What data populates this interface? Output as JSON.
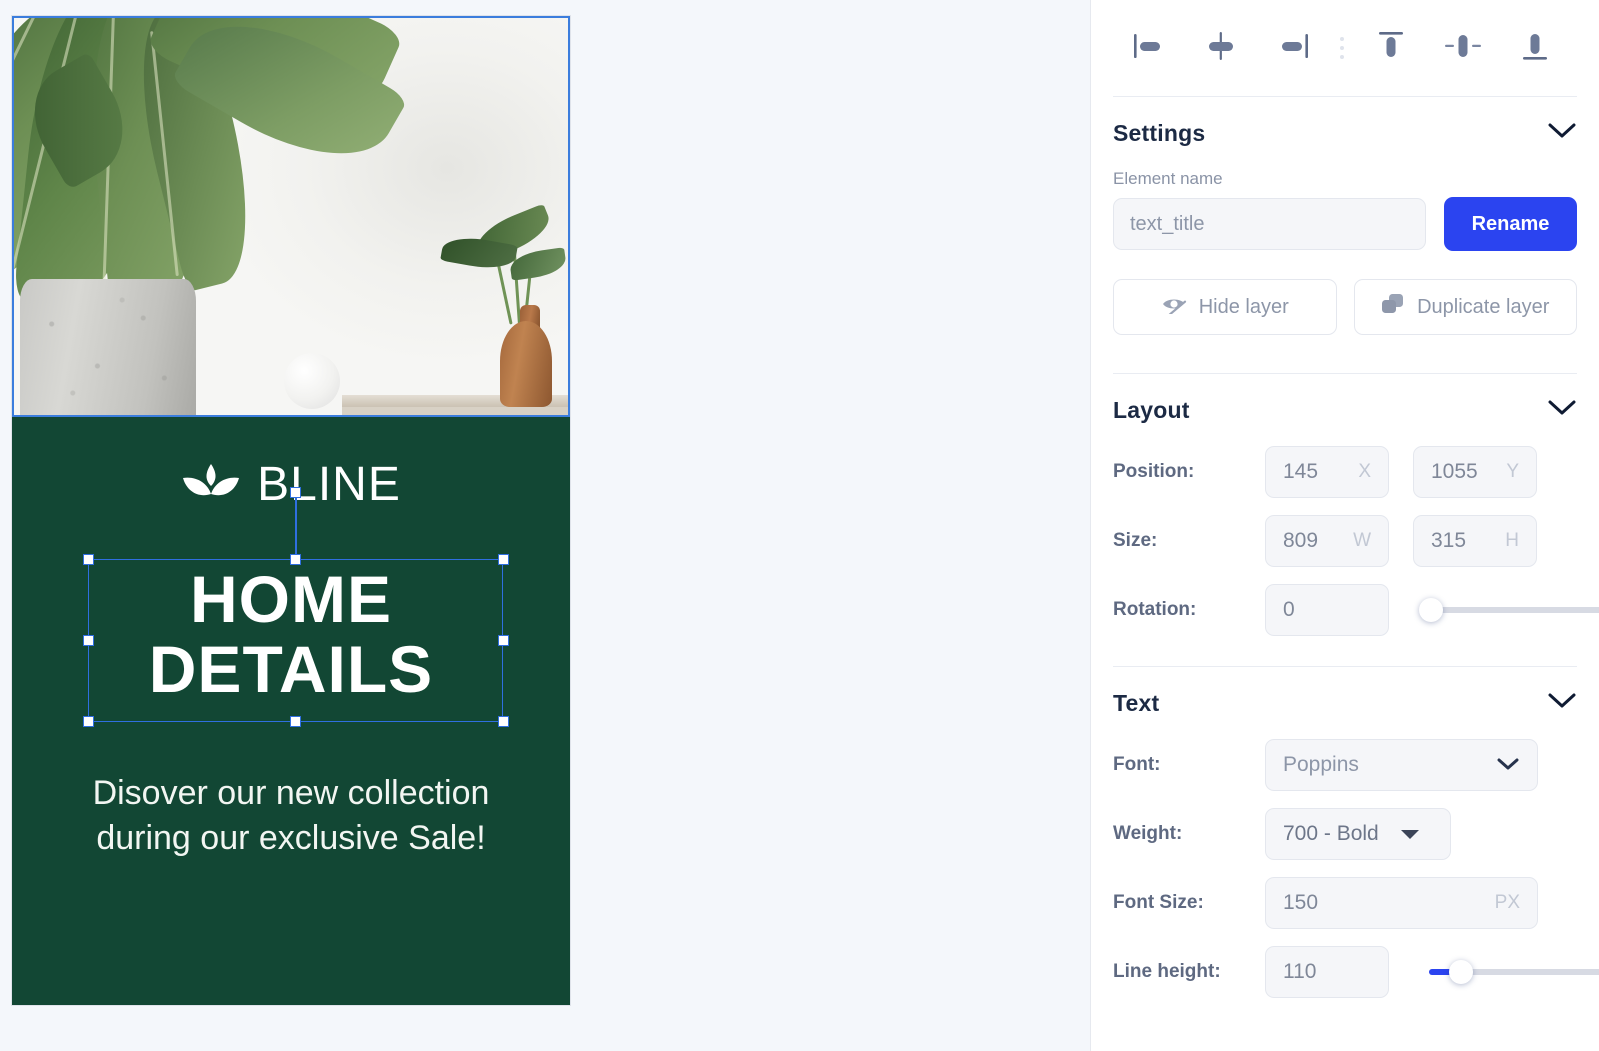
{
  "canvas": {
    "design": {
      "brand_name": "BLINE",
      "brand_mark": "lotus-leaf-logo",
      "headline_line1": "HOME",
      "headline_line2": "DETAILS",
      "tagline_line1": "Disover our new collection",
      "tagline_line2": "during our exclusive Sale!",
      "background_color": "#124734",
      "text_color": "#ffffff"
    },
    "selection": {
      "accent_color": "#2f6fe0",
      "image_layer_outline_color": "#3b7ddd"
    }
  },
  "panel": {
    "align_toolbar": {
      "items": [
        {
          "name": "align-left-icon",
          "label": "Align left"
        },
        {
          "name": "align-center-horizontal-icon",
          "label": "Align center horizontally"
        },
        {
          "name": "align-right-icon",
          "label": "Align right"
        },
        {
          "name": "more-options-dots-icon",
          "label": "More"
        },
        {
          "name": "align-top-icon",
          "label": "Align top"
        },
        {
          "name": "align-middle-vertical-icon",
          "label": "Align middle vertically"
        },
        {
          "name": "align-bottom-icon",
          "label": "Align bottom"
        }
      ]
    },
    "settings": {
      "title": "Settings",
      "element_name_label": "Element name",
      "element_name_value": "text_title",
      "rename_label": "Rename",
      "hide_layer_label": "Hide layer",
      "duplicate_layer_label": "Duplicate layer",
      "accent_color": "#2b44f0"
    },
    "layout": {
      "title": "Layout",
      "position_label": "Position:",
      "position_x": "145",
      "position_x_unit": "X",
      "position_y": "1055",
      "position_y_unit": "Y",
      "size_label": "Size:",
      "size_w": "809",
      "size_w_unit": "W",
      "size_h": "315",
      "size_h_unit": "H",
      "rotation_label": "Rotation:",
      "rotation_value": "0"
    },
    "text": {
      "title": "Text",
      "font_label": "Font:",
      "font_value": "Poppins",
      "weight_label": "Weight:",
      "weight_value": "700 - Bold",
      "font_size_label": "Font Size:",
      "font_size_value": "150",
      "font_size_unit": "PX",
      "line_height_label": "Line height:",
      "line_height_value": "110"
    }
  }
}
